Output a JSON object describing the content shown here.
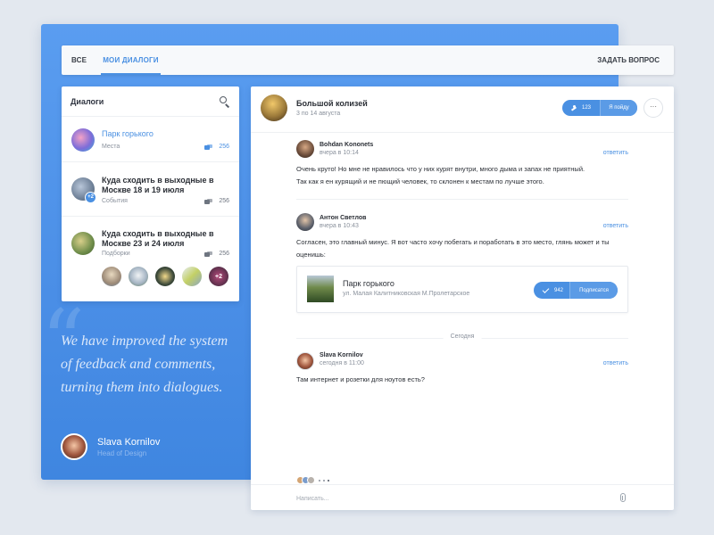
{
  "nav": {
    "tab_all": "ВСЕ",
    "tab_mine": "МОИ ДИАЛОГИ",
    "ask_question": "ЗАДАТЬ ВОПРОС"
  },
  "sidebar": {
    "title": "Диалоги",
    "items": [
      {
        "title": "Парк горького",
        "subtitle": "Места",
        "count": "256"
      },
      {
        "title": "Куда сходить в выходные в Москве 18 и 19 июля",
        "subtitle": "События",
        "count": "256",
        "badge": "+2"
      },
      {
        "title": "Куда сходить в выходные в Москве 23 и 24 июля",
        "subtitle": "Подборки",
        "count": "256",
        "thumb_more": "+2"
      }
    ]
  },
  "quote": {
    "text": "We have improved the system of feedback and comments, turning them into dialogues.",
    "author": "Slava Kornilov",
    "role": "Head of Design"
  },
  "chat": {
    "title": "Большой колизей",
    "dates": "3 по 14 августа",
    "go_count": "123",
    "go_label": "Я пойду",
    "more": "···",
    "messages": [
      {
        "name": "Bohdan Kononets",
        "time": "вчера в 10:14",
        "reply": "ответить",
        "text": "Очень круто! Но мне не нравилось что у них курят внутри, много дыма и запах не приятный. Так как я ен курящий и не пющий человек, то склонен к местам по лучше этого."
      },
      {
        "name": "Антон Светлов",
        "time": "вчера в 10:43",
        "reply": "ответить",
        "text": "Согласен, это главный минус. Я вот часто хочу побегать и поработать в это место, глянь может и ты оценишь:"
      },
      {
        "name": "Slava Kornilov",
        "time": "сегодня в 11:00",
        "reply": "ответить",
        "text": "Там интернет и розетки для ноутов есть?"
      }
    ],
    "place": {
      "name": "Парк горького",
      "address": "ул. Малая Калитниковская М.Пролетарское",
      "subscribers": "942",
      "subscribe_label": "Подписатся"
    },
    "day_separator": "Сегодня",
    "compose_placeholder": "Написать..."
  },
  "colors": {
    "accent": "#4a90e2",
    "panel_blue": "#4a8ee6",
    "background": "#e3e8ef"
  }
}
